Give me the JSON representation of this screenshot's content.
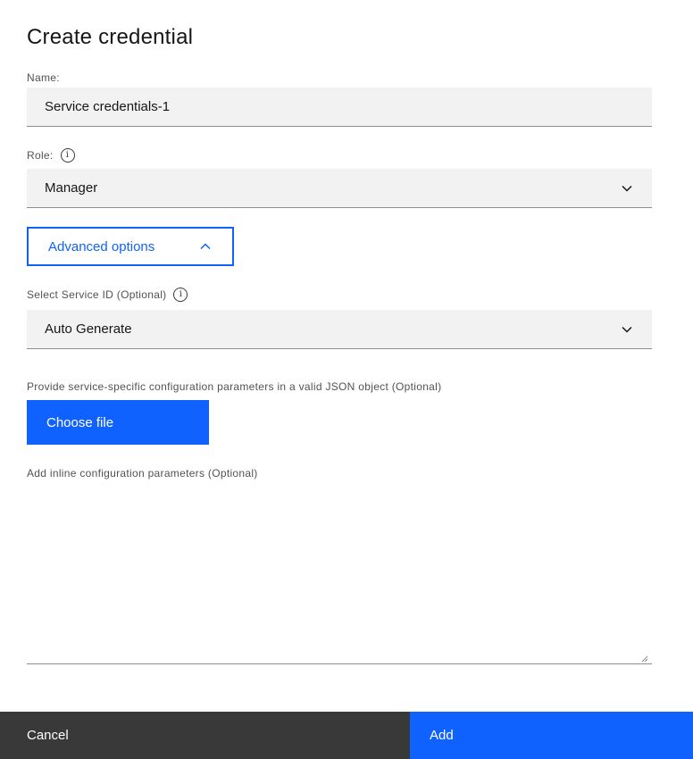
{
  "dialog": {
    "title": "Create credential"
  },
  "name_field": {
    "label": "Name:",
    "value": "Service credentials-1"
  },
  "role_field": {
    "label": "Role:",
    "value": "Manager",
    "info_icon": "info-icon"
  },
  "advanced_options": {
    "label": "Advanced options",
    "icon": "chevron-up-icon"
  },
  "service_id_field": {
    "label": "Select Service ID (Optional)",
    "value": "Auto Generate",
    "info_icon": "info-icon"
  },
  "config_file": {
    "label": "Provide service-specific configuration parameters in a valid JSON object (Optional)",
    "button_label": "Choose file"
  },
  "inline_config": {
    "label": "Add inline configuration parameters (Optional)",
    "value": ""
  },
  "footer": {
    "cancel_label": "Cancel",
    "add_label": "Add"
  },
  "colors": {
    "primary": "#0f62fe",
    "secondary": "#393939",
    "field_bg": "#f2f2f2"
  }
}
